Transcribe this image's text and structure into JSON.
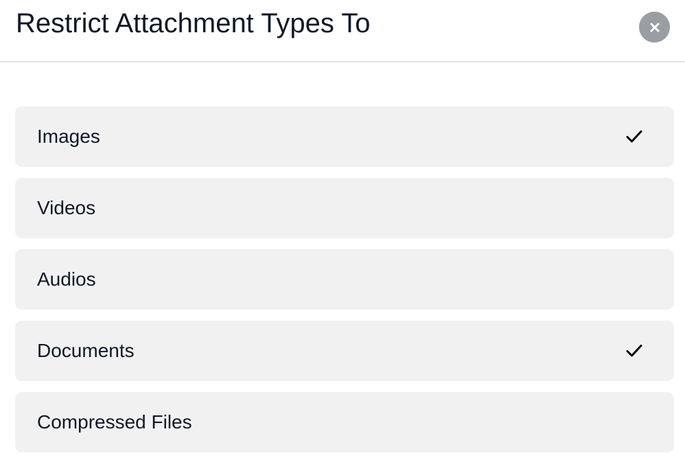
{
  "dialog": {
    "title": "Restrict Attachment Types To",
    "close_icon": "close-icon"
  },
  "options": [
    {
      "label": "Images",
      "selected": true
    },
    {
      "label": "Videos",
      "selected": false
    },
    {
      "label": "Audios",
      "selected": false
    },
    {
      "label": "Documents",
      "selected": true
    },
    {
      "label": "Compressed Files",
      "selected": false
    }
  ],
  "icons": {
    "selected": "checkmark-icon"
  },
  "colors": {
    "close_button_bg": "#9a9da3",
    "option_bg": "#f1f1f1",
    "text": "#101828"
  }
}
